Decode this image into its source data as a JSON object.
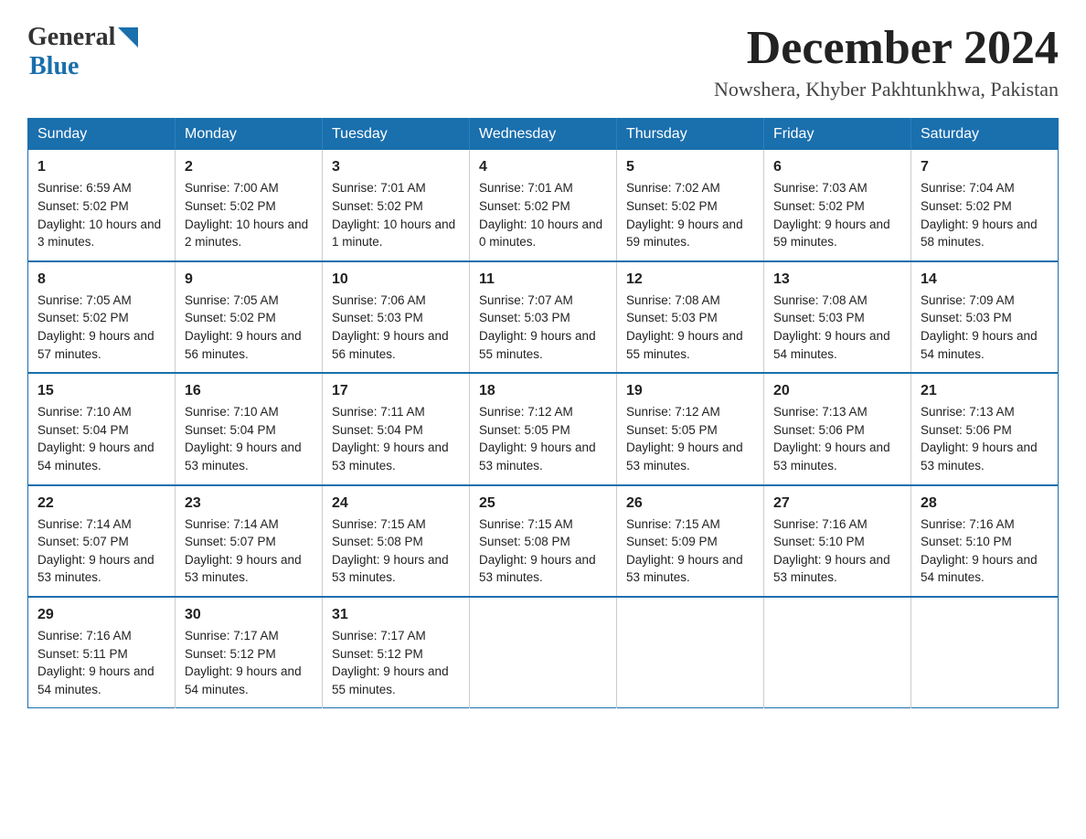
{
  "header": {
    "month_year": "December 2024",
    "location": "Nowshera, Khyber Pakhtunkhwa, Pakistan",
    "logo_general": "General",
    "logo_blue": "Blue"
  },
  "weekdays": [
    "Sunday",
    "Monday",
    "Tuesday",
    "Wednesday",
    "Thursday",
    "Friday",
    "Saturday"
  ],
  "weeks": [
    [
      {
        "day": "1",
        "sunrise": "6:59 AM",
        "sunset": "5:02 PM",
        "daylight": "10 hours and 3 minutes."
      },
      {
        "day": "2",
        "sunrise": "7:00 AM",
        "sunset": "5:02 PM",
        "daylight": "10 hours and 2 minutes."
      },
      {
        "day": "3",
        "sunrise": "7:01 AM",
        "sunset": "5:02 PM",
        "daylight": "10 hours and 1 minute."
      },
      {
        "day": "4",
        "sunrise": "7:01 AM",
        "sunset": "5:02 PM",
        "daylight": "10 hours and 0 minutes."
      },
      {
        "day": "5",
        "sunrise": "7:02 AM",
        "sunset": "5:02 PM",
        "daylight": "9 hours and 59 minutes."
      },
      {
        "day": "6",
        "sunrise": "7:03 AM",
        "sunset": "5:02 PM",
        "daylight": "9 hours and 59 minutes."
      },
      {
        "day": "7",
        "sunrise": "7:04 AM",
        "sunset": "5:02 PM",
        "daylight": "9 hours and 58 minutes."
      }
    ],
    [
      {
        "day": "8",
        "sunrise": "7:05 AM",
        "sunset": "5:02 PM",
        "daylight": "9 hours and 57 minutes."
      },
      {
        "day": "9",
        "sunrise": "7:05 AM",
        "sunset": "5:02 PM",
        "daylight": "9 hours and 56 minutes."
      },
      {
        "day": "10",
        "sunrise": "7:06 AM",
        "sunset": "5:03 PM",
        "daylight": "9 hours and 56 minutes."
      },
      {
        "day": "11",
        "sunrise": "7:07 AM",
        "sunset": "5:03 PM",
        "daylight": "9 hours and 55 minutes."
      },
      {
        "day": "12",
        "sunrise": "7:08 AM",
        "sunset": "5:03 PM",
        "daylight": "9 hours and 55 minutes."
      },
      {
        "day": "13",
        "sunrise": "7:08 AM",
        "sunset": "5:03 PM",
        "daylight": "9 hours and 54 minutes."
      },
      {
        "day": "14",
        "sunrise": "7:09 AM",
        "sunset": "5:03 PM",
        "daylight": "9 hours and 54 minutes."
      }
    ],
    [
      {
        "day": "15",
        "sunrise": "7:10 AM",
        "sunset": "5:04 PM",
        "daylight": "9 hours and 54 minutes."
      },
      {
        "day": "16",
        "sunrise": "7:10 AM",
        "sunset": "5:04 PM",
        "daylight": "9 hours and 53 minutes."
      },
      {
        "day": "17",
        "sunrise": "7:11 AM",
        "sunset": "5:04 PM",
        "daylight": "9 hours and 53 minutes."
      },
      {
        "day": "18",
        "sunrise": "7:12 AM",
        "sunset": "5:05 PM",
        "daylight": "9 hours and 53 minutes."
      },
      {
        "day": "19",
        "sunrise": "7:12 AM",
        "sunset": "5:05 PM",
        "daylight": "9 hours and 53 minutes."
      },
      {
        "day": "20",
        "sunrise": "7:13 AM",
        "sunset": "5:06 PM",
        "daylight": "9 hours and 53 minutes."
      },
      {
        "day": "21",
        "sunrise": "7:13 AM",
        "sunset": "5:06 PM",
        "daylight": "9 hours and 53 minutes."
      }
    ],
    [
      {
        "day": "22",
        "sunrise": "7:14 AM",
        "sunset": "5:07 PM",
        "daylight": "9 hours and 53 minutes."
      },
      {
        "day": "23",
        "sunrise": "7:14 AM",
        "sunset": "5:07 PM",
        "daylight": "9 hours and 53 minutes."
      },
      {
        "day": "24",
        "sunrise": "7:15 AM",
        "sunset": "5:08 PM",
        "daylight": "9 hours and 53 minutes."
      },
      {
        "day": "25",
        "sunrise": "7:15 AM",
        "sunset": "5:08 PM",
        "daylight": "9 hours and 53 minutes."
      },
      {
        "day": "26",
        "sunrise": "7:15 AM",
        "sunset": "5:09 PM",
        "daylight": "9 hours and 53 minutes."
      },
      {
        "day": "27",
        "sunrise": "7:16 AM",
        "sunset": "5:10 PM",
        "daylight": "9 hours and 53 minutes."
      },
      {
        "day": "28",
        "sunrise": "7:16 AM",
        "sunset": "5:10 PM",
        "daylight": "9 hours and 54 minutes."
      }
    ],
    [
      {
        "day": "29",
        "sunrise": "7:16 AM",
        "sunset": "5:11 PM",
        "daylight": "9 hours and 54 minutes."
      },
      {
        "day": "30",
        "sunrise": "7:17 AM",
        "sunset": "5:12 PM",
        "daylight": "9 hours and 54 minutes."
      },
      {
        "day": "31",
        "sunrise": "7:17 AM",
        "sunset": "5:12 PM",
        "daylight": "9 hours and 55 minutes."
      },
      null,
      null,
      null,
      null
    ]
  ],
  "labels": {
    "sunrise": "Sunrise:",
    "sunset": "Sunset:",
    "daylight": "Daylight:"
  }
}
